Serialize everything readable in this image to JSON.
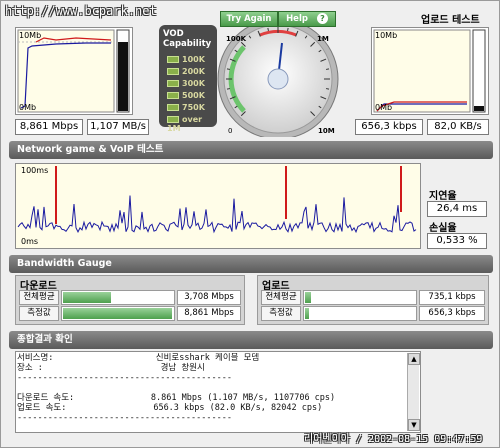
{
  "watermark_top": "http://www.bcpark.net",
  "watermark_bottom": "리어벤이아 / 2002-08-15 09:47:59",
  "download_graph": {
    "label_top": "10Mb",
    "label_bottom": "0Mb",
    "speed_mbps": "8,861 Mbps",
    "speed_mbs": "1,107 MB/s"
  },
  "upload_title": "업로드 테스트",
  "upload_graph": {
    "label_top": "10Mb",
    "label_bottom": "0Mb",
    "speed_kbps": "656,3 kbps",
    "speed_kbs": "82,0 KB/s"
  },
  "vod": {
    "title": "VOD Capability",
    "items": [
      "100K",
      "200K",
      "300K",
      "500K",
      "750K",
      "over 1M"
    ]
  },
  "buttons": {
    "try_again": "Try Again",
    "help": "Help",
    "help_icon": "question-icon"
  },
  "gauge": {
    "ticks": [
      "0",
      "100K",
      "200",
      "300",
      "500",
      "1M",
      "2M",
      "3M",
      "4M",
      "5M",
      "6M",
      "8M",
      "10M"
    ],
    "value_label": "8,861 Mbps"
  },
  "network": {
    "title": "Network game & VoIP 테스트",
    "label_top": "100ms",
    "label_bottom": "0ms",
    "latency_label": "지연율",
    "latency_value": "26,4 ms",
    "loss_label": "손실율",
    "loss_value": "0,533 %"
  },
  "bandwidth": {
    "title": "Bandwidth Gauge",
    "download": {
      "title": "다운로드",
      "rows": [
        {
          "label": "전체평균",
          "value": "3,708 Mbps",
          "fill": 0.43
        },
        {
          "label": "측정값",
          "value": "8,861 Mbps",
          "fill": 0.97
        }
      ]
    },
    "upload": {
      "title": "업로드",
      "rows": [
        {
          "label": "전체평균",
          "value": "735,1 kbps",
          "fill": 0.05
        },
        {
          "label": "측정값",
          "value": "656,3 kbps",
          "fill": 0.04
        }
      ]
    }
  },
  "summary": {
    "title": "종합결과 확인",
    "lines": [
      "서비스명:                    신비로sshark 케이블 모뎀",
      "장소 :                       경남 창원시",
      "------------------------------------------",
      "",
      "다운로드 속도:               8.861 Mbps (1.107 MB/s, 1107706 cps)",
      "업로드 속도:                 656.3 kbps (82.0 KB/s, 82042 cps)",
      "------------------------------------------"
    ]
  },
  "colors": {
    "bar_gray": "#6e6e6e",
    "fill_green": "#5aaa5a",
    "graph_blue": "#1a1aa0",
    "graph_red": "#d01a1a"
  }
}
